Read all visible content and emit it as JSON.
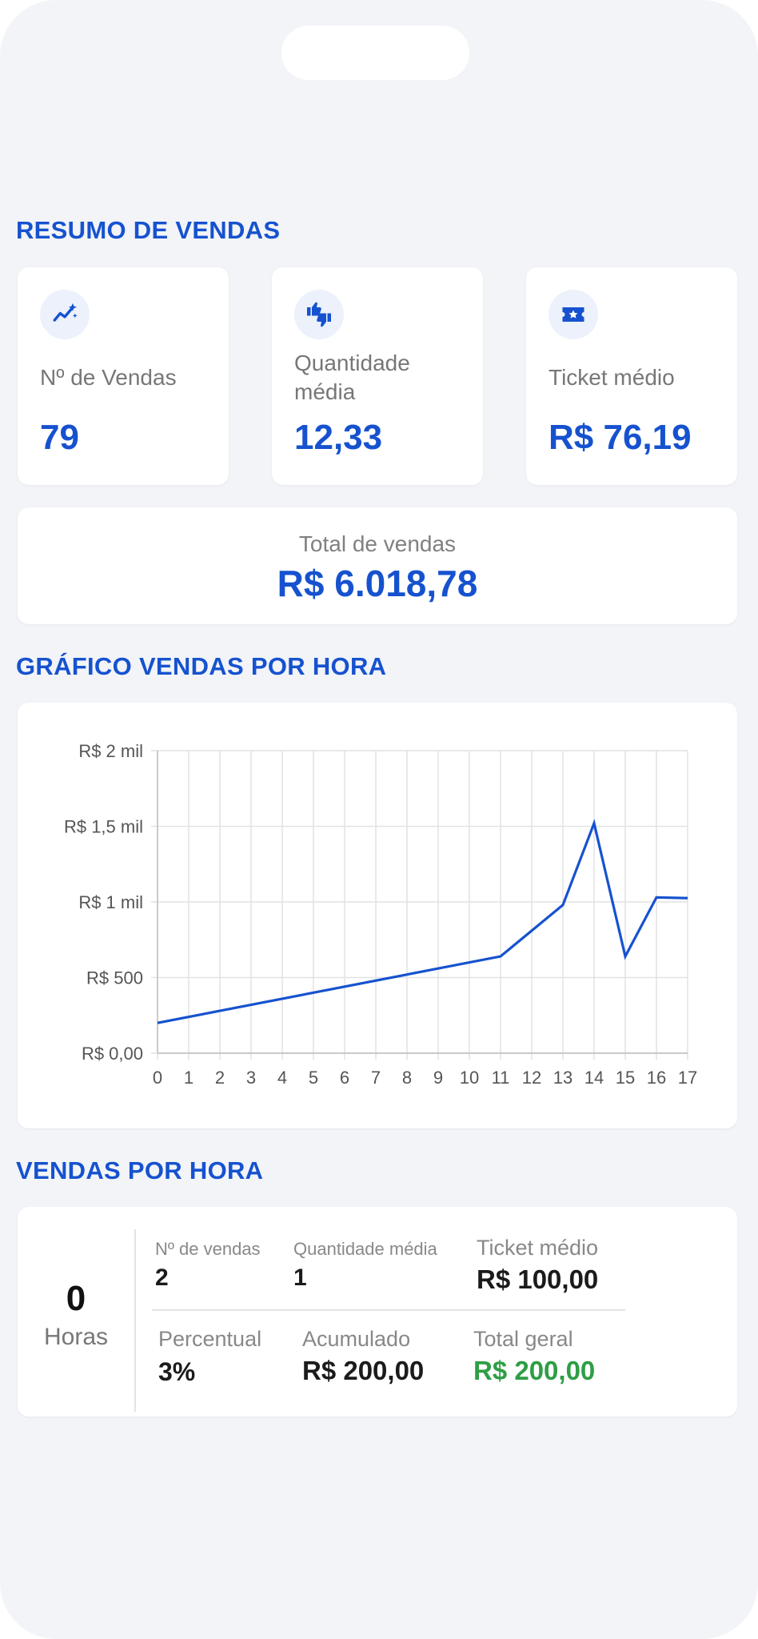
{
  "summary": {
    "title": "RESUMO DE VENDAS",
    "cards": [
      {
        "icon": "trend-sparkle-icon",
        "label": "Nº de Vendas",
        "value": "79"
      },
      {
        "icon": "thumbs-icon",
        "label_line1": "Quantidade",
        "label_line2": "média",
        "value": "12,33"
      },
      {
        "icon": "ticket-icon",
        "label": "Ticket médio",
        "value": "R$ 76,19"
      }
    ],
    "total_label": "Total de vendas",
    "total_value": "R$ 6.018,78"
  },
  "chart_section": {
    "title": "GRÁFICO VENDAS POR HORA"
  },
  "chart_data": {
    "type": "line",
    "x": [
      0,
      11,
      13,
      14,
      15,
      16,
      17
    ],
    "values": [
      200,
      640,
      980,
      1520,
      640,
      1030,
      1025
    ],
    "x_ticks": [
      "0",
      "1",
      "2",
      "3",
      "4",
      "5",
      "6",
      "7",
      "8",
      "9",
      "10",
      "11",
      "12",
      "13",
      "14",
      "15",
      "16",
      "17"
    ],
    "y_ticks": [
      "R$ 0,00",
      "R$ 500",
      "R$ 1 mil",
      "R$ 1,5 mil",
      "R$ 2 mil"
    ],
    "xlim": [
      0,
      17
    ],
    "ylim": [
      0,
      2000
    ],
    "grid": true,
    "line_color": "#1652cf"
  },
  "hourly": {
    "title": "VENDAS POR HORA",
    "hour_value": "0",
    "hour_label": "Horas",
    "sales_count_label": "Nº de vendas",
    "sales_count_value": "2",
    "avg_qty_label": "Quantidade média",
    "avg_qty_value": "1",
    "ticket_label": "Ticket médio",
    "ticket_value": "R$ 100,00",
    "percent_label": "Percentual",
    "percent_value": "3%",
    "accum_label": "Acumulado",
    "accum_value": "R$ 200,00",
    "total_label": "Total geral",
    "total_value": "R$ 200,00",
    "total_color": "#2e9e45"
  }
}
